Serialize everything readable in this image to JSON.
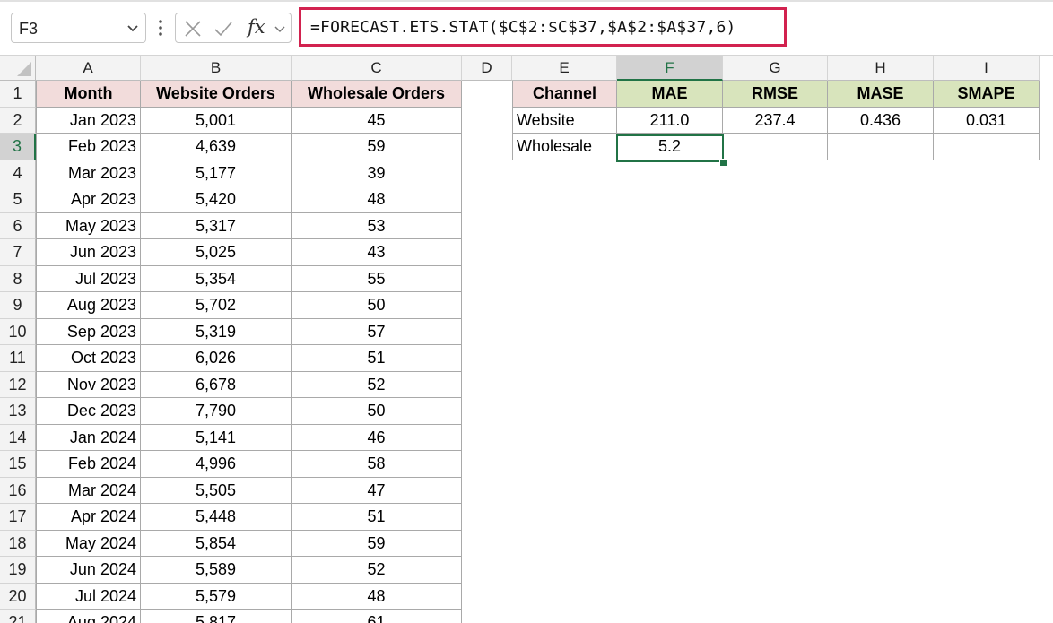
{
  "formula_bar": {
    "name_box": "F3",
    "formula": "=FORECAST.ETS.STAT($C$2:$C$37,$A$2:$A$37,6)",
    "fx_label": "fx",
    "highlight_color": "#d2224f"
  },
  "columns": [
    "A",
    "B",
    "C",
    "D",
    "E",
    "F",
    "G",
    "H",
    "I"
  ],
  "selected_column": "F",
  "selected_row": "3",
  "rows": [
    "1",
    "2",
    "3",
    "4",
    "5",
    "6",
    "7",
    "8",
    "9",
    "10",
    "11",
    "12",
    "13",
    "14",
    "15",
    "16",
    "17",
    "18",
    "19",
    "20",
    "21"
  ],
  "table_left": {
    "headers": [
      "Month",
      "Website Orders",
      "Wholesale Orders"
    ],
    "data": [
      [
        "Jan 2023",
        "5,001",
        "45"
      ],
      [
        "Feb 2023",
        "4,639",
        "59"
      ],
      [
        "Mar 2023",
        "5,177",
        "39"
      ],
      [
        "Apr 2023",
        "5,420",
        "48"
      ],
      [
        "May 2023",
        "5,317",
        "53"
      ],
      [
        "Jun 2023",
        "5,025",
        "43"
      ],
      [
        "Jul 2023",
        "5,354",
        "55"
      ],
      [
        "Aug 2023",
        "5,702",
        "50"
      ],
      [
        "Sep 2023",
        "5,319",
        "57"
      ],
      [
        "Oct 2023",
        "6,026",
        "51"
      ],
      [
        "Nov 2023",
        "6,678",
        "52"
      ],
      [
        "Dec 2023",
        "7,790",
        "50"
      ],
      [
        "Jan 2024",
        "5,141",
        "46"
      ],
      [
        "Feb 2024",
        "4,996",
        "58"
      ],
      [
        "Mar 2024",
        "5,505",
        "47"
      ],
      [
        "Apr 2024",
        "5,448",
        "51"
      ],
      [
        "May 2024",
        "5,854",
        "59"
      ],
      [
        "Jun 2024",
        "5,589",
        "52"
      ],
      [
        "Jul 2024",
        "5,579",
        "48"
      ],
      [
        "Aug 2024",
        "5,817",
        "61"
      ]
    ]
  },
  "table_right": {
    "headers": [
      "Channel",
      "MAE",
      "RMSE",
      "MASE",
      "SMAPE"
    ],
    "data": [
      [
        "Website",
        "211.0",
        "237.4",
        "0.436",
        "0.031"
      ],
      [
        "Wholesale",
        "5.2",
        "",
        "",
        ""
      ]
    ]
  },
  "colors": {
    "header_pink": "#f2dcdb",
    "header_green": "#d8e4bc",
    "selection_green": "#217346"
  }
}
